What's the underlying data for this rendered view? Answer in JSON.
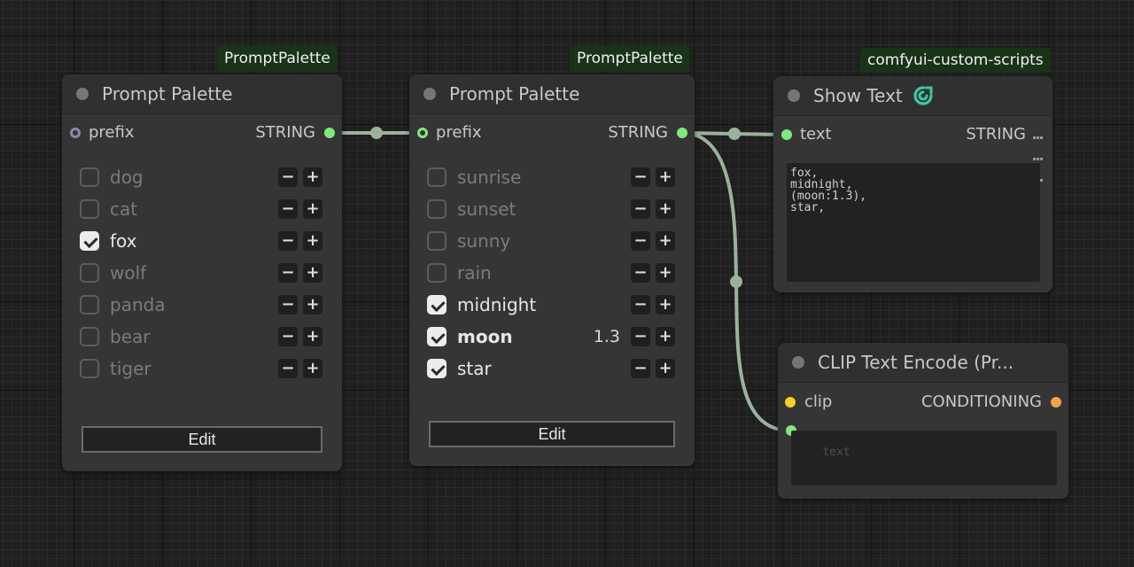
{
  "colors": {
    "canvas_bg": "#1f1f1f",
    "node_bg": "#353535",
    "link": "#9cb19c",
    "badge_bg": "#183318",
    "string_slot": "#7eea7e",
    "clip_slot": "#f6ce27",
    "conditioning_slot": "#f3a14a",
    "icon_teal": "#3cc9a3"
  },
  "nodes": {
    "palette1": {
      "badge": "PromptPalette",
      "title": "Prompt Palette",
      "input_label": "prefix",
      "output_label": "STRING",
      "items": [
        {
          "label": "dog",
          "checked": false
        },
        {
          "label": "cat",
          "checked": false
        },
        {
          "label": "fox",
          "checked": true
        },
        {
          "label": "wolf",
          "checked": false
        },
        {
          "label": "panda",
          "checked": false
        },
        {
          "label": "bear",
          "checked": false
        },
        {
          "label": "tiger",
          "checked": false
        }
      ],
      "minus_label": "−",
      "plus_label": "+",
      "edit_label": "Edit"
    },
    "palette2": {
      "badge": "PromptPalette",
      "title": "Prompt Palette",
      "input_label": "prefix",
      "output_label": "STRING",
      "items": [
        {
          "label": "sunrise",
          "checked": false,
          "weight": ""
        },
        {
          "label": "sunset",
          "checked": false,
          "weight": ""
        },
        {
          "label": "sunny",
          "checked": false,
          "weight": ""
        },
        {
          "label": "rain",
          "checked": false,
          "weight": ""
        },
        {
          "label": "midnight",
          "checked": true,
          "weight": ""
        },
        {
          "label": "moon",
          "checked": true,
          "weight": "1.3",
          "bold": true
        },
        {
          "label": "star",
          "checked": true,
          "weight": ""
        }
      ],
      "minus_label": "−",
      "plus_label": "+",
      "edit_label": "Edit"
    },
    "show_text": {
      "badge": "comfyui-custom-scripts",
      "title": "Show Text",
      "input_label": "text",
      "output_label": "STRING",
      "text": "fox,\nmidnight,\n(moon:1.3),\nstar,"
    },
    "clip": {
      "title": "CLIP Text Encode (Pr...",
      "input_label": "clip",
      "output_label": "CONDITIONING",
      "text_placeholder": "text"
    }
  }
}
